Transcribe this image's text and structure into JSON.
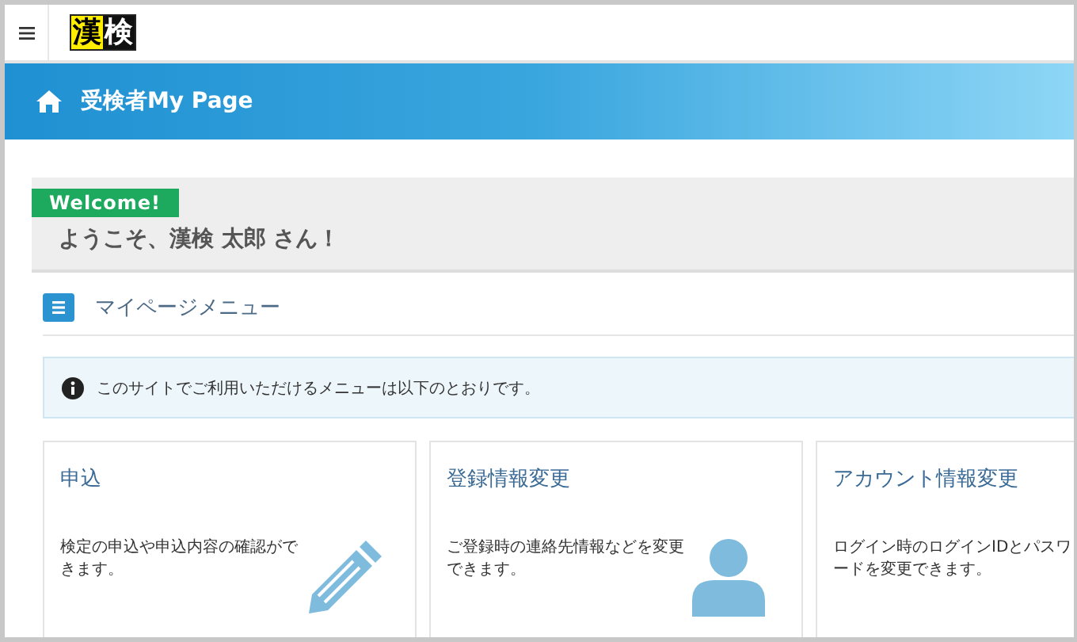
{
  "header": {
    "logo": [
      "漢",
      "検"
    ]
  },
  "banner": {
    "title": "受検者My Page"
  },
  "welcome": {
    "tag": "Welcome!",
    "greeting": "ようこそ、漢検 太郎 さん！"
  },
  "menu": {
    "title": "マイページメニュー",
    "notice": "このサイトでご利用いただけるメニューは以下のとおりです。"
  },
  "cards": [
    {
      "title": "申込",
      "description": "検定の申込や申込内容の確認ができます。",
      "kind": "apply"
    },
    {
      "title": "登録情報変更",
      "description": "ご登録時の連絡先情報などを変更できます。",
      "kind": "profile"
    },
    {
      "title": "アカウント情報変更",
      "description": "ログイン時のログインIDとパスワードを変更できます。",
      "kind": "account"
    }
  ]
}
